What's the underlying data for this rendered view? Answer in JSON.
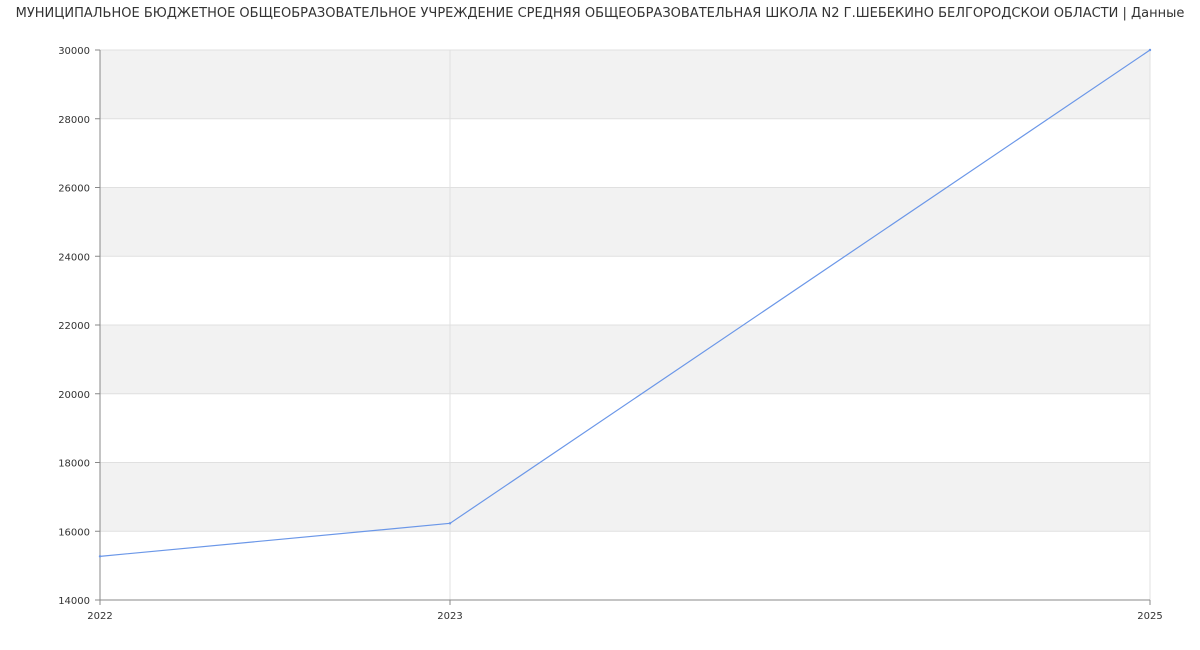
{
  "chart_data": {
    "type": "line",
    "title": "МУНИЦИПАЛЬНОЕ БЮДЖЕТНОЕ ОБЩЕОБРАЗОВАТЕЛЬНОЕ УЧРЕЖДЕНИЕ СРЕДНЯЯ ОБЩЕОБРАЗОВАТЕЛЬНАЯ ШКОЛА N2 Г.ШЕБЕКИНО БЕЛГОРОДСКОЙ ОБЛАСТИ | Данные",
    "xlabel": "",
    "ylabel": "",
    "x": [
      2022,
      2023,
      2025
    ],
    "series": [
      {
        "values": [
          15270,
          16230,
          30000
        ]
      }
    ],
    "xticks": [
      "2022",
      "2023",
      "2025"
    ],
    "yticks": [
      "14000",
      "16000",
      "18000",
      "20000",
      "22000",
      "24000",
      "26000",
      "28000",
      "30000"
    ],
    "ylim": [
      14000,
      30000
    ],
    "grid": true,
    "colors": {
      "line": "#6b97e8",
      "band": "#f2f2f2",
      "grid": "#e0e0e0",
      "axis": "#888888"
    }
  }
}
